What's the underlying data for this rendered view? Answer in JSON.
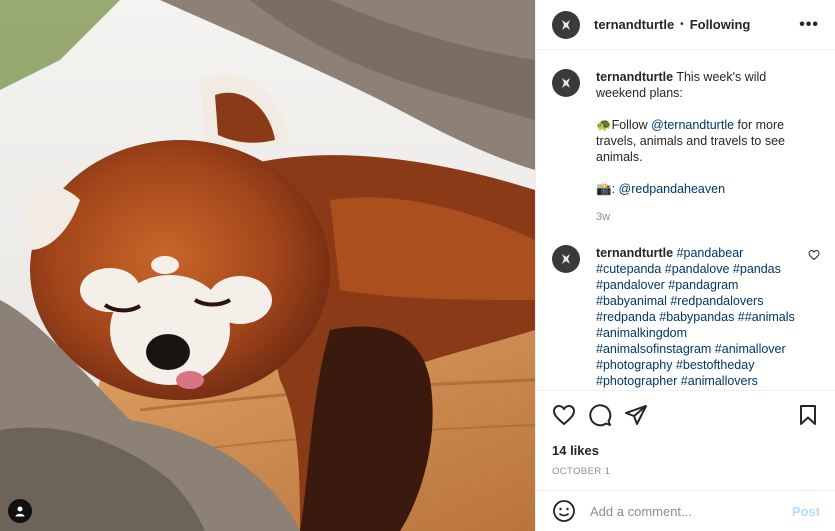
{
  "post": {
    "username": "ternandturtle",
    "separator": "•",
    "follow_status": "Following",
    "more_label": "•••"
  },
  "caption": {
    "username": "ternandturtle",
    "line1": "This week's wild weekend plans:",
    "follow_prefix": "🐢Follow ",
    "follow_mention": "@ternandturtle",
    "follow_suffix": " for more travels, animals and travels to see animals.",
    "credit_prefix": "📸: ",
    "credit_mention": "@redpandaheaven",
    "time": "3w"
  },
  "comment": {
    "username": "ternandturtle",
    "hashtags": "#pandabear #cutepanda #pandalove #pandas #pandalover #pandagram #babyanimal #redpandalovers #redpanda #babypandas ##animals #animalkingdom #animalsofinstagram #animallover #photography #bestoftheday #photographer #animallovers"
  },
  "actions": {
    "like_icon": "heart-icon",
    "comment_icon": "comment-icon",
    "share_icon": "share-icon",
    "save_icon": "bookmark-icon",
    "likes": "14 likes",
    "date": "OCTOBER 1"
  },
  "add_comment": {
    "placeholder": "Add a comment...",
    "post_label": "Post",
    "emoji_icon": "emoji-icon"
  },
  "colors": {
    "link": "#00376b",
    "post_disabled": "#b2dffc",
    "muted": "#8e8e8e"
  }
}
